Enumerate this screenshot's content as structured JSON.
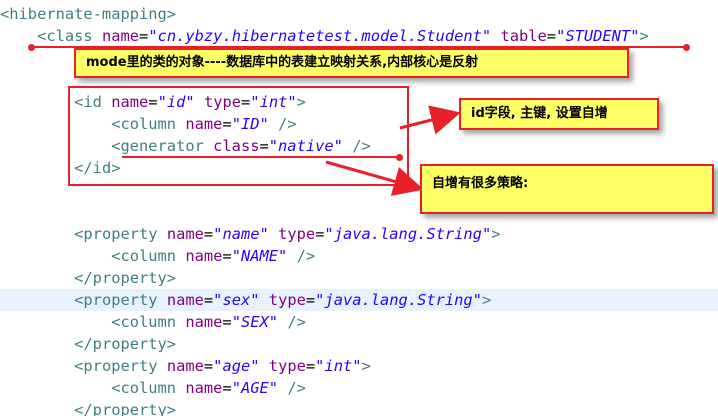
{
  "code_lines": [
    {
      "id": "line-hibernate-mapping-open",
      "tokens": [
        {
          "t": "tag",
          "s": "<hibernate-mapping>"
        }
      ]
    },
    {
      "id": "line-class-open",
      "tokens": [
        {
          "t": "text",
          "s": "    "
        },
        {
          "t": "tag",
          "s": "<class "
        },
        {
          "t": "attr",
          "s": "name"
        },
        {
          "t": "eq",
          "s": "="
        },
        {
          "t": "val",
          "s": "\"cn.ybzy.hibernatetest.model.Student\""
        },
        {
          "t": "text",
          "s": " "
        },
        {
          "t": "attr",
          "s": "table"
        },
        {
          "t": "eq",
          "s": "="
        },
        {
          "t": "val",
          "s": "\"STUDENT\""
        },
        {
          "t": "tag",
          "s": ">"
        }
      ]
    },
    {
      "id": "line-blank-1",
      "tokens": []
    },
    {
      "id": "line-blank-2",
      "tokens": []
    },
    {
      "id": "line-id-open",
      "tokens": [
        {
          "t": "text",
          "s": "        "
        },
        {
          "t": "tag",
          "s": "<id "
        },
        {
          "t": "attr",
          "s": "name"
        },
        {
          "t": "eq",
          "s": "="
        },
        {
          "t": "val",
          "s": "\"id\""
        },
        {
          "t": "text",
          "s": " "
        },
        {
          "t": "attr",
          "s": "type"
        },
        {
          "t": "eq",
          "s": "="
        },
        {
          "t": "val",
          "s": "\"int\""
        },
        {
          "t": "tag",
          "s": ">"
        }
      ]
    },
    {
      "id": "line-column-id",
      "tokens": [
        {
          "t": "text",
          "s": "            "
        },
        {
          "t": "tag",
          "s": "<column "
        },
        {
          "t": "attr",
          "s": "name"
        },
        {
          "t": "eq",
          "s": "="
        },
        {
          "t": "val",
          "s": "\"ID\""
        },
        {
          "t": "text",
          "s": " "
        },
        {
          "t": "tag",
          "s": "/>"
        }
      ]
    },
    {
      "id": "line-generator",
      "tokens": [
        {
          "t": "text",
          "s": "            "
        },
        {
          "t": "tag",
          "s": "<generator "
        },
        {
          "t": "attr",
          "s": "class"
        },
        {
          "t": "eq",
          "s": "="
        },
        {
          "t": "val",
          "s": "\"native\""
        },
        {
          "t": "text",
          "s": " "
        },
        {
          "t": "tag",
          "s": "/>"
        }
      ]
    },
    {
      "id": "line-id-close",
      "tokens": [
        {
          "t": "text",
          "s": "        "
        },
        {
          "t": "tag",
          "s": "</id>"
        }
      ]
    },
    {
      "id": "line-blank-3",
      "tokens": []
    },
    {
      "id": "line-blank-4",
      "tokens": []
    },
    {
      "id": "line-property-name-open",
      "tokens": [
        {
          "t": "text",
          "s": "        "
        },
        {
          "t": "tag",
          "s": "<property "
        },
        {
          "t": "attr",
          "s": "name"
        },
        {
          "t": "eq",
          "s": "="
        },
        {
          "t": "val",
          "s": "\"name\""
        },
        {
          "t": "text",
          "s": " "
        },
        {
          "t": "attr",
          "s": "type"
        },
        {
          "t": "eq",
          "s": "="
        },
        {
          "t": "val",
          "s": "\"java.lang.String\""
        },
        {
          "t": "tag",
          "s": ">"
        }
      ]
    },
    {
      "id": "line-column-name",
      "tokens": [
        {
          "t": "text",
          "s": "            "
        },
        {
          "t": "tag",
          "s": "<column "
        },
        {
          "t": "attr",
          "s": "name"
        },
        {
          "t": "eq",
          "s": "="
        },
        {
          "t": "val",
          "s": "\"NAME\""
        },
        {
          "t": "text",
          "s": " "
        },
        {
          "t": "tag",
          "s": "/>"
        }
      ]
    },
    {
      "id": "line-property-name-close",
      "tokens": [
        {
          "t": "text",
          "s": "        "
        },
        {
          "t": "tag",
          "s": "</property>"
        }
      ]
    },
    {
      "id": "line-property-sex-open",
      "current": true,
      "tokens": [
        {
          "t": "text",
          "s": "        "
        },
        {
          "t": "tag",
          "s": "<property "
        },
        {
          "t": "attr",
          "s": "name"
        },
        {
          "t": "eq",
          "s": "="
        },
        {
          "t": "val",
          "s": "\"sex\""
        },
        {
          "t": "text",
          "s": " "
        },
        {
          "t": "attr",
          "s": "type"
        },
        {
          "t": "eq",
          "s": "="
        },
        {
          "t": "val",
          "s": "\"java.lang.String\""
        },
        {
          "t": "tag",
          "s": ">"
        }
      ]
    },
    {
      "id": "line-column-sex",
      "tokens": [
        {
          "t": "text",
          "s": "            "
        },
        {
          "t": "tag",
          "s": "<column "
        },
        {
          "t": "attr",
          "s": "name"
        },
        {
          "t": "eq",
          "s": "="
        },
        {
          "t": "val",
          "s": "\"SEX\""
        },
        {
          "t": "text",
          "s": " "
        },
        {
          "t": "tag",
          "s": "/>"
        }
      ]
    },
    {
      "id": "line-property-sex-close",
      "tokens": [
        {
          "t": "text",
          "s": "        "
        },
        {
          "t": "tag",
          "s": "</property>"
        }
      ]
    },
    {
      "id": "line-property-age-open",
      "tokens": [
        {
          "t": "text",
          "s": "        "
        },
        {
          "t": "tag",
          "s": "<property "
        },
        {
          "t": "attr",
          "s": "name"
        },
        {
          "t": "eq",
          "s": "="
        },
        {
          "t": "val",
          "s": "\"age\""
        },
        {
          "t": "text",
          "s": " "
        },
        {
          "t": "attr",
          "s": "type"
        },
        {
          "t": "eq",
          "s": "="
        },
        {
          "t": "val",
          "s": "\"int\""
        },
        {
          "t": "tag",
          "s": ">"
        }
      ]
    },
    {
      "id": "line-column-age",
      "tokens": [
        {
          "t": "text",
          "s": "            "
        },
        {
          "t": "tag",
          "s": "<column "
        },
        {
          "t": "attr",
          "s": "name"
        },
        {
          "t": "eq",
          "s": "="
        },
        {
          "t": "val",
          "s": "\"AGE\""
        },
        {
          "t": "text",
          "s": " "
        },
        {
          "t": "tag",
          "s": "/>"
        }
      ]
    },
    {
      "id": "line-property-age-close",
      "tokens": [
        {
          "t": "text",
          "s": "        "
        },
        {
          "t": "tag",
          "s": "</property>"
        }
      ]
    }
  ],
  "annotations": {
    "class_note": "mode里的类的对象----数据库中的表建立映射关系,内部核心是反射",
    "id_note": "id字段, 主键, 设置自增",
    "generator_note": "自增有很多策略:"
  },
  "colors": {
    "accent": "#e8202a",
    "callout_bg": "#ffff66",
    "tag": "#3f7f7f",
    "attribute": "#7f007f",
    "value": "#2a00ff",
    "current_line": "#e8f2fe"
  }
}
